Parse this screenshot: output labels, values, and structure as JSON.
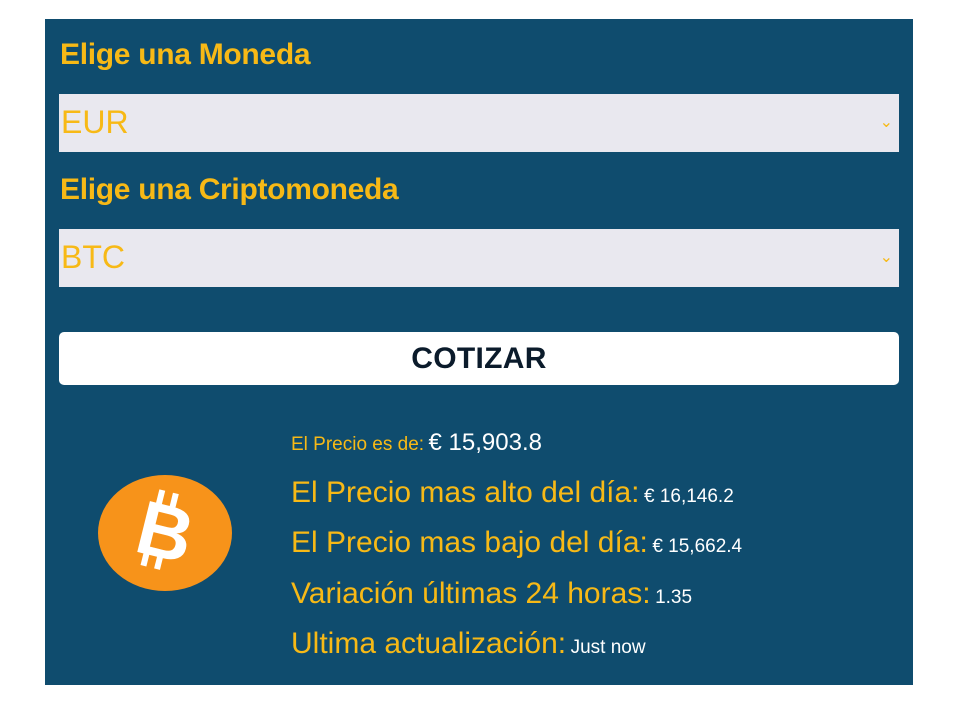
{
  "form": {
    "currency_label": "Elige una Moneda",
    "currency_value": "EUR",
    "crypto_label": "Elige una Criptomoneda",
    "crypto_value": "BTC",
    "submit_label": "COTIZAR"
  },
  "result": {
    "price_label": "El Precio es de:",
    "price_value": "€ 15,903.8",
    "high_label": "El Precio mas alto del día:",
    "high_value": "€ 16,146.2",
    "low_label": "El Precio mas bajo del día:",
    "low_value": "€ 15,662.4",
    "change_label": "Variación últimas 24 horas:",
    "change_value": "1.35",
    "updated_label": "Ultima actualización:",
    "updated_value": "Just now"
  },
  "icons": {
    "coin": "bitcoin-icon",
    "dropdown": "chevron-down-icon"
  },
  "colors": {
    "panel": "#0f4c6e",
    "accent": "#f7b916",
    "select_bg": "#e9e8ef",
    "bitcoin_orange": "#f7931a"
  }
}
